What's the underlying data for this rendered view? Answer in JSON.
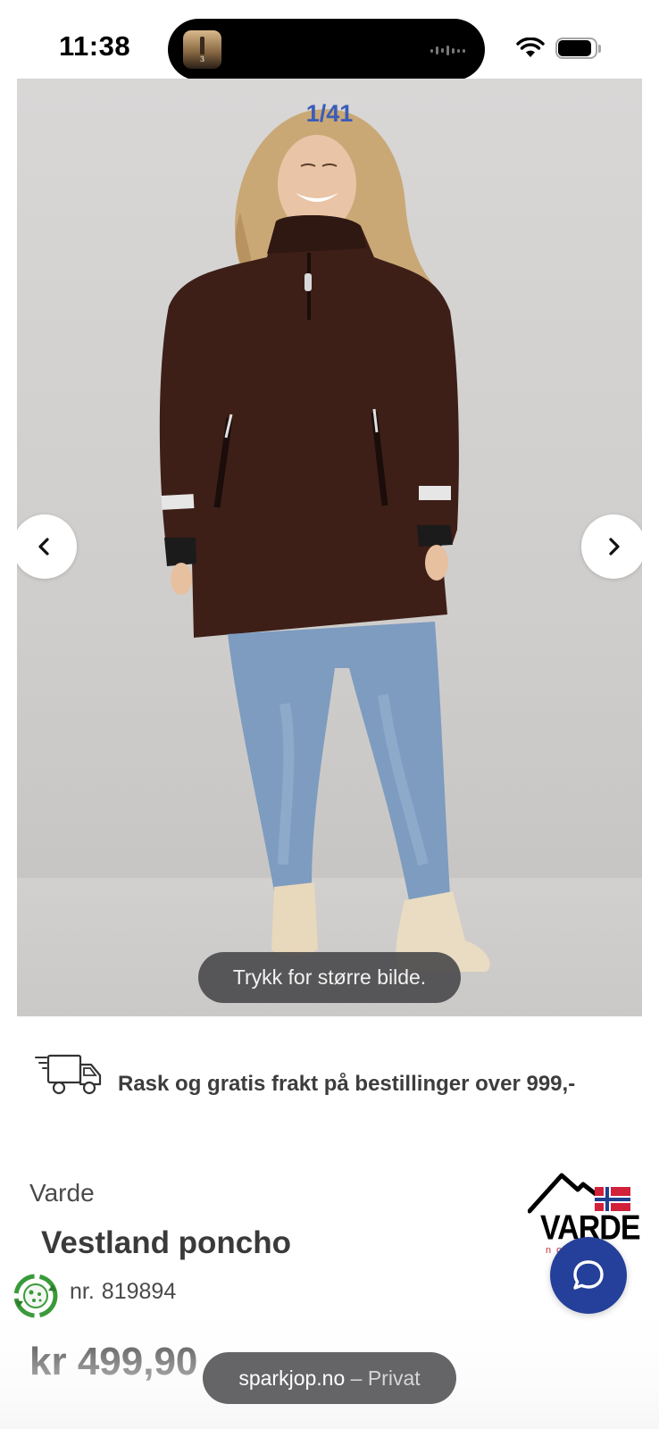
{
  "status_bar": {
    "time": "11:38",
    "now_playing_art_label": "3",
    "icons": [
      "wifi-icon",
      "battery-icon"
    ]
  },
  "gallery": {
    "counter": "1/41",
    "zoom_hint": "Trykk for større bilde.",
    "prev_icon": "chevron-left-icon",
    "next_icon": "chevron-right-icon"
  },
  "shipping": {
    "icon": "delivery-truck-icon",
    "text": "Rask og gratis frakt på bestillinger over 999,-"
  },
  "product": {
    "brand": "Varde",
    "title": "Vestland poncho",
    "article_label": "nr.",
    "article_number": "819894",
    "price": "kr 499,90",
    "sustainability_icon": "recycle-icon"
  },
  "brand_logo": {
    "word": "VARDE",
    "sub": "norway"
  },
  "chat": {
    "icon": "chat-bubble-icon"
  },
  "browser": {
    "domain": "sparkjop.no",
    "separator": "–",
    "mode": "Privat"
  },
  "colors": {
    "accent": "#25409a",
    "counter": "#3b5cb8",
    "text": "#333333",
    "poncho": "#3d1f18"
  }
}
